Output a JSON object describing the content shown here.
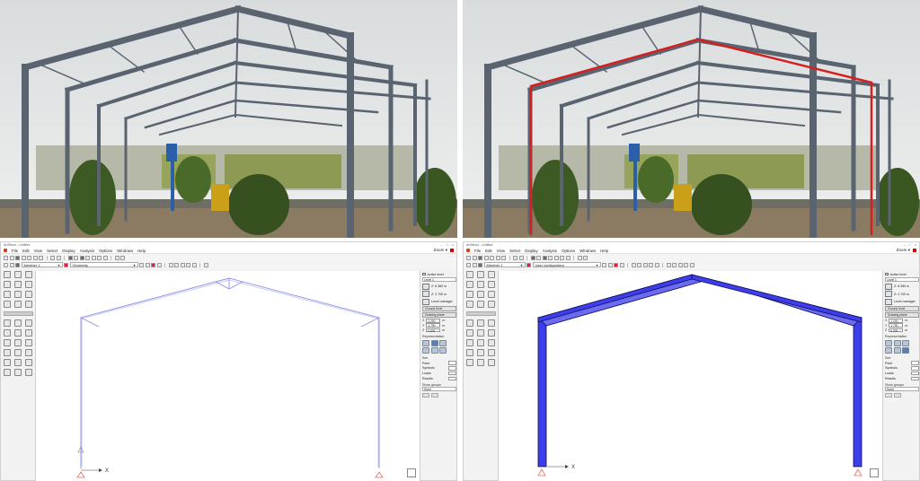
{
  "photos": {
    "left": {
      "name": "steel-frame-photo"
    },
    "right": {
      "name": "steel-frame-photo-highlighted",
      "highlight_color": "#d62020"
    }
  },
  "app": {
    "title_left": "ArtStruct - Untitled",
    "menu": [
      "File",
      "Edit",
      "View",
      "Select",
      "Display",
      "Analysis",
      "Options",
      "Windows",
      "Help"
    ],
    "zoom_label": "Zoom ▾",
    "toolbar_left": {
      "member_select": "Member 1",
      "config_select": "Geometry"
    },
    "toolbar_right": {
      "member_select": "Member 1",
      "config_select": "User configuration"
    },
    "right_panel": {
      "active_level_label": "Active level",
      "level_value": "Level 1",
      "z_top": "Z: 6.360 m",
      "z_bottom": "Z: 2.700 m",
      "level_manager": "Level manager",
      "ground_level": "Ground level",
      "drawing_plane": "Drawing plane",
      "x_label": "X",
      "x_value": "1.200",
      "x_unit": "m",
      "y_label": "Y",
      "y_value": "1.700",
      "y_unit": "m",
      "zc_label": "Z",
      "zc_value": "0.200",
      "zc_unit": "m",
      "representation": "Representation",
      "see": "See",
      "see_items": [
        "Point",
        "Symbols",
        "Loads",
        "Results"
      ],
      "show_groups": "Show groups",
      "group_value": "None"
    },
    "axis_label": "X",
    "model_colors": {
      "wire": "#8a8fe8",
      "member": "#3d3dea",
      "member_edge": "#0d0d5a"
    }
  }
}
